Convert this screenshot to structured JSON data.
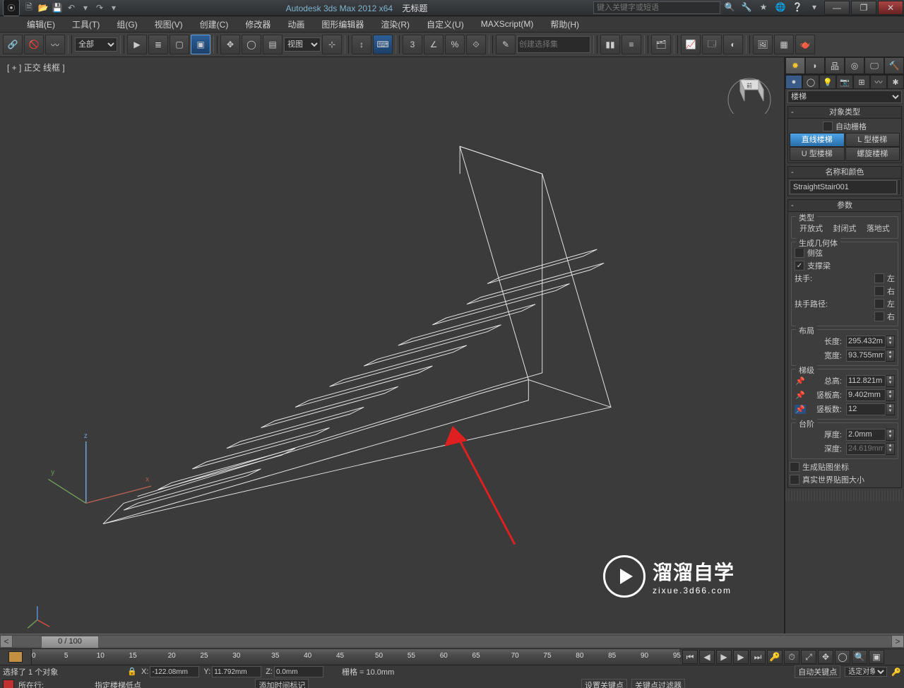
{
  "title": {
    "app": "Autodesk 3ds Max  2012 x64",
    "doc": "无标题"
  },
  "search_placeholder": "键入关键字或短语",
  "menu": [
    "编辑(E)",
    "工具(T)",
    "组(G)",
    "视图(V)",
    "创建(C)",
    "修改器",
    "动画",
    "图形编辑器",
    "渲染(R)",
    "自定义(U)",
    "MAXScript(M)",
    "帮助(H)"
  ],
  "toolbar": {
    "filter": "全部",
    "ref": "视图",
    "set": "创建选择集"
  },
  "viewport_label": "[ + ] 正交  线框 ]",
  "panel": {
    "category": "楼梯",
    "rollout_objtype": "对象类型",
    "auto_grid": "自动栅格",
    "types": [
      "直线楼梯",
      "L 型楼梯",
      "U 型楼梯",
      "螺旋楼梯"
    ],
    "rollout_name": "名称和颜色",
    "obj_name": "StraightStair001",
    "rollout_params": "参数",
    "grp_type": "类型",
    "radio_type": [
      "开放式",
      "封闭式",
      "落地式"
    ],
    "grp_gen": "生成几何体",
    "ck_side": "侧弦",
    "ck_support": "支撑梁",
    "handrail": "扶手:",
    "handrail_path": "扶手路径:",
    "left": "左",
    "right": "右",
    "grp_layout": "布局",
    "length": "长度:",
    "length_v": "295.432m",
    "width": "宽度:",
    "width_v": "93.755mm",
    "grp_steps": "梯级",
    "total": "总高:",
    "total_v": "112.821m",
    "riser": "竖板高:",
    "riser_v": "9.402mm",
    "count": "竖板数:",
    "count_v": "12",
    "grp_tread": "台阶",
    "thick": "厚度:",
    "thick_v": "2.0mm",
    "depth": "深度:",
    "depth_v": "24.619mm",
    "genuv": "生成贴图坐标",
    "realuv": "真实世界贴图大小"
  },
  "timeslider": "0 / 100",
  "ruler_ticks": [
    "0",
    "5",
    "10",
    "15",
    "20",
    "25",
    "30",
    "35",
    "40",
    "45",
    "50",
    "55",
    "60",
    "65",
    "70",
    "75",
    "80",
    "85",
    "90",
    "95"
  ],
  "status": {
    "sel": "选择了 1 个对象",
    "x": "-122.08mm",
    "y": "11.792mm",
    "z": "0.0mm",
    "grid": "栅格 = 10.0mm",
    "autokey": "自动关键点",
    "selobj": "选定对象",
    "hint2": "指定楼梯低点",
    "setkey": "设置关键点",
    "keyfilter": "关键点过滤器",
    "addtime": "添加时间标记"
  },
  "status2": {
    "where": "所在行:"
  },
  "watermark": {
    "t1": "溜溜自学",
    "t2": "zixue.3d66.com"
  }
}
